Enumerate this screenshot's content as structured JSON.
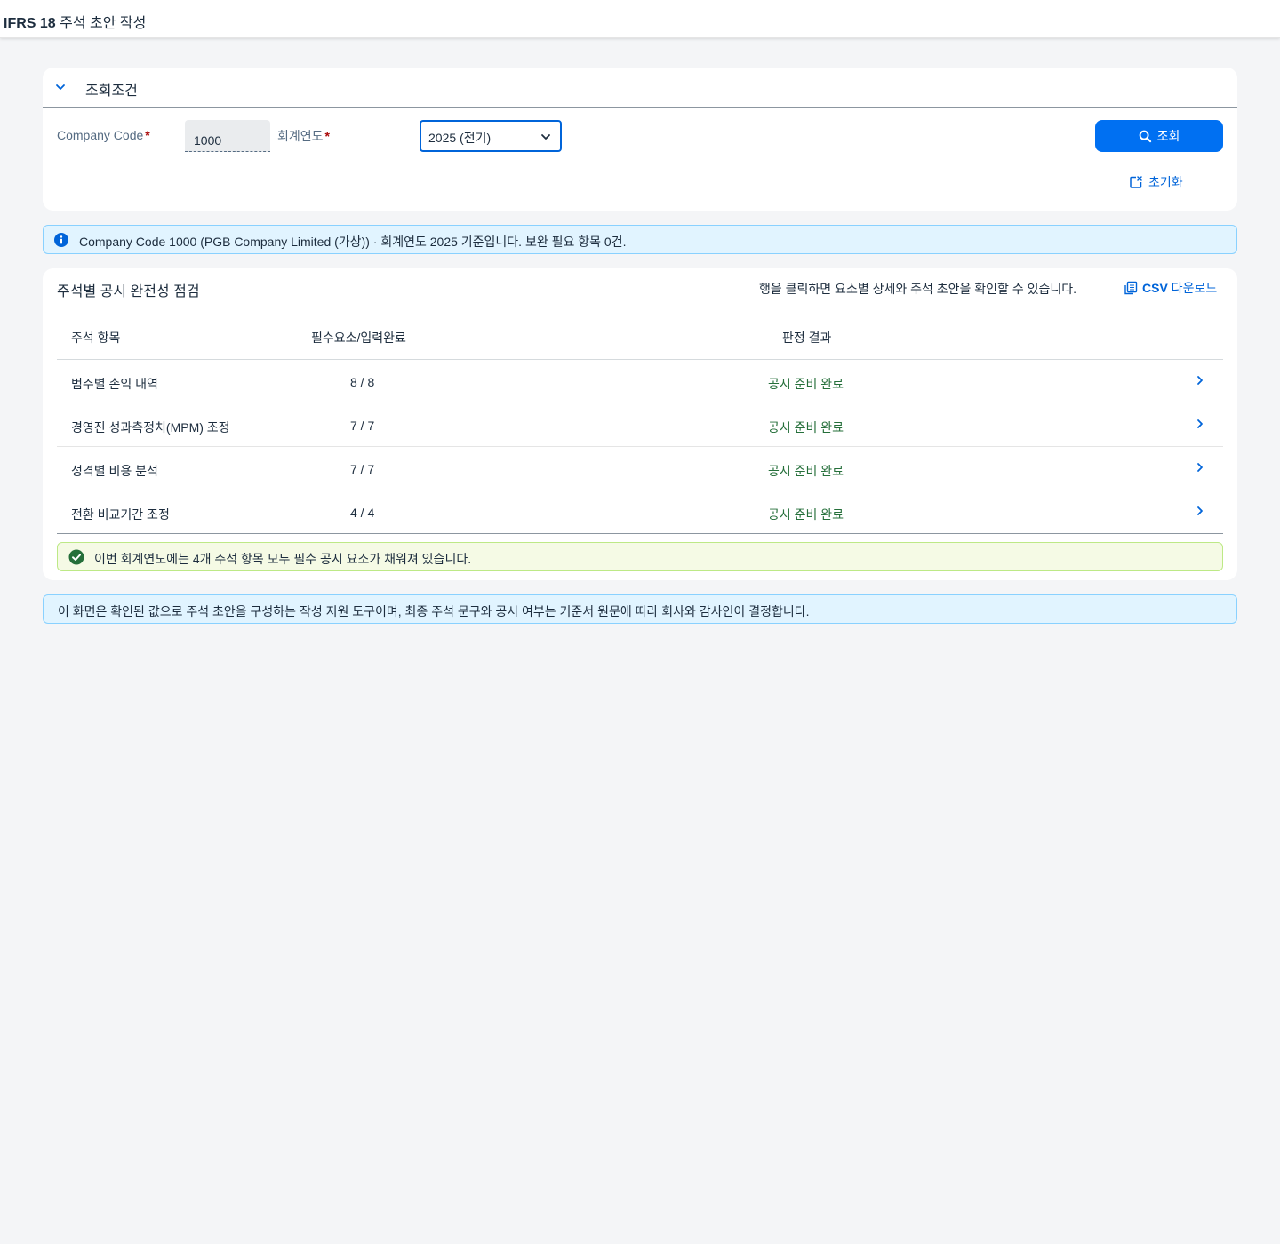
{
  "app": {
    "title_bold": "IFRS 18",
    "title_rest": " 주석 초안 작성"
  },
  "filter": {
    "title": "조회조건",
    "company_code_label": "Company Code",
    "company_code_value": "1000",
    "year_label": "회계연도",
    "year_value": "2025 (전기)",
    "required_mark": "*",
    "search_label": "조회",
    "reset_label": "초기화"
  },
  "info": {
    "text": "Company Code 1000 (PGB Company Limited (가상)) · 회계연도 2025 기준입니다. 보완 필요 항목 0건."
  },
  "check": {
    "title": "주석별 공시 완전성 점검",
    "hint": "행을 클릭하면 요소별 상세와 주석 초안을 확인할 수 있습니다.",
    "csv_bold": "CSV",
    "csv_rest": " 다운로드",
    "columns": [
      "주석 항목",
      "필수요소/입력완료",
      "판정 결과"
    ],
    "rows": [
      {
        "item": "범주별 손익 내역",
        "count": "8 / 8",
        "status": "공시 준비 완료"
      },
      {
        "item": "경영진 성과측정치(MPM) 조정",
        "count": "7 / 7",
        "status": "공시 준비 완료"
      },
      {
        "item": "성격별 비용 분석",
        "count": "7 / 7",
        "status": "공시 준비 완료"
      },
      {
        "item": "전환 비교기간 조정",
        "count": "4 / 4",
        "status": "공시 준비 완료"
      }
    ],
    "success_text": "이번 회계연도에는 4개 주석 항목 모두 필수 공시 요소가 채워져 있습니다."
  },
  "footer_note": {
    "text": "이 화면은 확인된 값으로 주석 초안을 구성하는 작성 지원 도구이며, 최종 주석 문구와 공시 여부는 기준서 원문에 따라 회사와 감사인이 결정합니다."
  },
  "colors": {
    "primary": "#0070f2",
    "link": "#0064d9",
    "success": "#256f3a",
    "required": "#aa0808",
    "info_bg": "#e1f4ff",
    "success_bg": "#f5fae5"
  },
  "icons": [
    "chevron-down-icon",
    "search-icon",
    "reset-icon",
    "info-icon",
    "csv-export-icon",
    "chevron-right-icon",
    "success-check-icon"
  ]
}
